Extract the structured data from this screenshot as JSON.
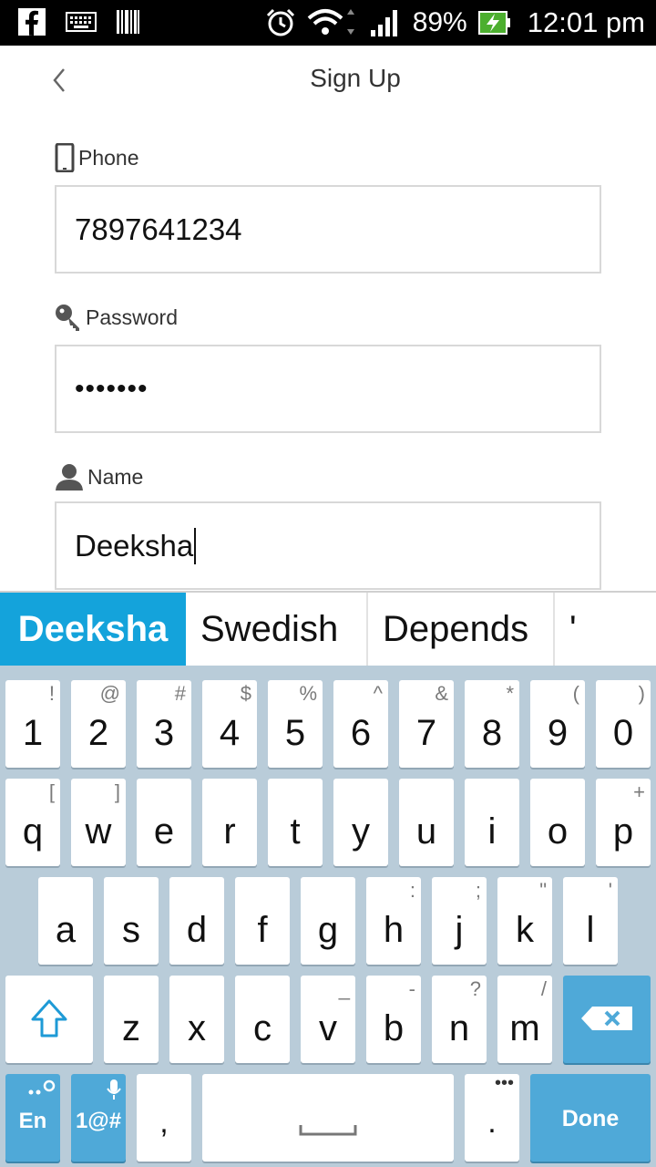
{
  "status_bar": {
    "battery_text": "89%",
    "time": "12:01 pm",
    "icons": [
      "facebook-icon",
      "keyboard-icon",
      "barcode-icon",
      "alarm-icon",
      "wifi-icon",
      "signal-icon",
      "battery-charging-icon"
    ]
  },
  "header": {
    "title": "Sign Up",
    "back_icon": "chevron-left-icon"
  },
  "form": {
    "phone": {
      "label": "Phone",
      "value": "7897641234",
      "icon": "phone-icon"
    },
    "password": {
      "label": "Password",
      "value": "•••••••",
      "icon": "key-icon"
    },
    "name": {
      "label": "Name",
      "value": "Deeksha",
      "icon": "person-icon"
    }
  },
  "suggestions": [
    "Deeksha",
    "Swedish",
    "Depends",
    "'"
  ],
  "keyboard": {
    "row_numbers": [
      {
        "main": "1",
        "alt": "!"
      },
      {
        "main": "2",
        "alt": "@"
      },
      {
        "main": "3",
        "alt": "#"
      },
      {
        "main": "4",
        "alt": "$"
      },
      {
        "main": "5",
        "alt": "%"
      },
      {
        "main": "6",
        "alt": "^"
      },
      {
        "main": "7",
        "alt": "&"
      },
      {
        "main": "8",
        "alt": "*"
      },
      {
        "main": "9",
        "alt": "("
      },
      {
        "main": "0",
        "alt": ")"
      }
    ],
    "row_top": [
      {
        "main": "q",
        "alt": "["
      },
      {
        "main": "w",
        "alt": "]"
      },
      {
        "main": "e",
        "alt": ""
      },
      {
        "main": "r",
        "alt": ""
      },
      {
        "main": "t",
        "alt": ""
      },
      {
        "main": "y",
        "alt": ""
      },
      {
        "main": "u",
        "alt": ""
      },
      {
        "main": "i",
        "alt": ""
      },
      {
        "main": "o",
        "alt": ""
      },
      {
        "main": "p",
        "alt": "+"
      }
    ],
    "row_home": [
      {
        "main": "a",
        "alt": ""
      },
      {
        "main": "s",
        "alt": ""
      },
      {
        "main": "d",
        "alt": ""
      },
      {
        "main": "f",
        "alt": ""
      },
      {
        "main": "g",
        "alt": ""
      },
      {
        "main": "h",
        "alt": ":"
      },
      {
        "main": "j",
        "alt": ";"
      },
      {
        "main": "k",
        "alt": "\""
      },
      {
        "main": "l",
        "alt": "'"
      }
    ],
    "row_bottom": [
      {
        "main": "z",
        "alt": ""
      },
      {
        "main": "x",
        "alt": ""
      },
      {
        "main": "c",
        "alt": ""
      },
      {
        "main": "v",
        "alt": "_"
      },
      {
        "main": "b",
        "alt": "-"
      },
      {
        "main": "n",
        "alt": "?"
      },
      {
        "main": "m",
        "alt": "/"
      }
    ],
    "lang_label": "En",
    "symbols_label": "1@#",
    "comma": ",",
    "period": ".",
    "period_alt": "•••",
    "done_label": "Done",
    "accent_color": "#4fa9d8",
    "suggestion_highlight": "#14a3db"
  }
}
